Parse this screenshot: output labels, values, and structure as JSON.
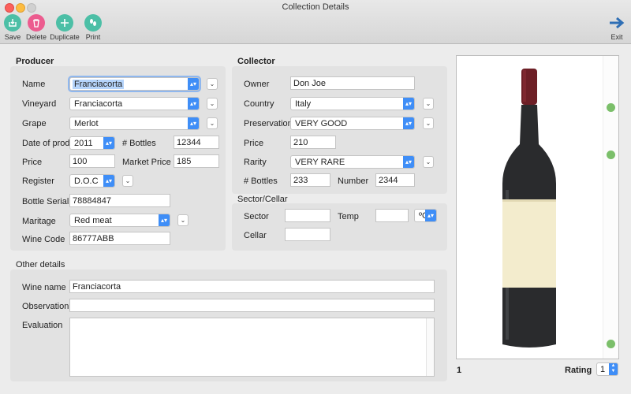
{
  "window": {
    "title": "Collection Details"
  },
  "toolbar": {
    "save": "Save",
    "delete": "Delete",
    "duplicate": "Duplicate",
    "print": "Print",
    "exit": "Exit",
    "save_icon": "tray-arrow-icon",
    "delete_icon": "trash-icon",
    "duplicate_icon": "plus-icon",
    "print_icon": "footprints-icon",
    "exit_icon": "arrow-right-icon",
    "accent_color": "#4cbfa6",
    "delete_color": "#ec5c8f",
    "exit_color": "#2f6fb5"
  },
  "producer": {
    "title": "Producer",
    "name_label": "Name",
    "name_value": "Franciacorta",
    "vineyard_label": "Vineyard",
    "vineyard_value": "Franciacorta",
    "grape_label": "Grape",
    "grape_value": "Merlot",
    "date_label": "Date of prod.",
    "date_value": "2011",
    "bottles_label": "# Bottles",
    "bottles_value": "12344",
    "price_label": "Price",
    "price_value": "100",
    "market_price_label": "Market Price",
    "market_price_value": "185",
    "register_label": "Register",
    "register_value": "D.O.C",
    "serial_label": "Bottle Serial",
    "serial_value": "78884847",
    "maritage_label": "Maritage",
    "maritage_value": "Red meat",
    "code_label": "Wine Code",
    "code_value": "86777ABB"
  },
  "collector": {
    "title": "Collector",
    "owner_label": "Owner",
    "owner_value": "Don Joe",
    "country_label": "Country",
    "country_value": "Italy",
    "preservation_label": "Preservation",
    "preservation_value": "VERY GOOD",
    "price_label": "Price",
    "price_value": "210",
    "rarity_label": "Rarity",
    "rarity_value": "VERY RARE",
    "bottles_label": "# Bottles",
    "bottles_value": "233",
    "number_label": "Number",
    "number_value": "2344"
  },
  "sector": {
    "title": "Sector/Cellar",
    "sector_label": "Sector",
    "sector_value": "",
    "temp_label": "Temp",
    "temp_value": "",
    "unit_value": "ºC",
    "cellar_label": "Cellar",
    "cellar_value": ""
  },
  "other": {
    "title": "Other details",
    "wine_name_label": "Wine name",
    "wine_name_value": "Franciacorta",
    "observation_label": "Observation",
    "observation_value": "",
    "evaluation_label": "Evaluation",
    "evaluation_value": ""
  },
  "footer": {
    "page_number": "1",
    "rating_label": "Rating",
    "rating_value": "1"
  },
  "colors": {
    "select_arrow": "#3f8ef7",
    "focus_ring": "#8fb7ee",
    "wine_label": "#f3eccd",
    "bottle": "#2a2b2d"
  }
}
